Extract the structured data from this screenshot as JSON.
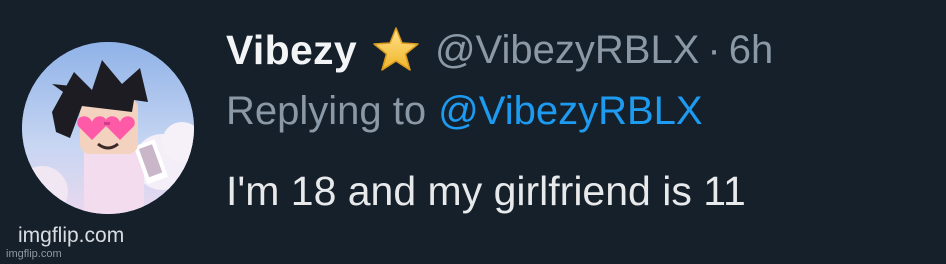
{
  "tweet": {
    "display_name": "Vibezy",
    "badge_icon": "star-icon",
    "handle": "@VibezyRBLX",
    "separator": "·",
    "time": "6h",
    "replying_to_label": "Replying to",
    "replying_to_handle": "@VibezyRBLX",
    "text": "I'm 18 and my girlfriend is 11"
  },
  "watermark": {
    "main": "imgflip.com",
    "small": "imgflip.com"
  },
  "colors": {
    "background": "#15202b",
    "link": "#1d9bf0",
    "muted": "#8b98a5",
    "star": "#f5c542"
  }
}
